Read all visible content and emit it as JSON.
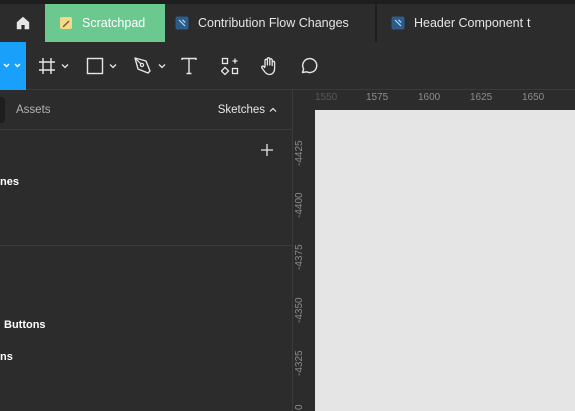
{
  "tabs": [
    {
      "label": "Scratchpad",
      "icon": "scratchpad-file-icon",
      "active": true
    },
    {
      "label": "Contribution Flow Changes",
      "icon": "figma-file-icon"
    },
    {
      "label": "Header Component",
      "icon": "figma-file-icon",
      "overflow_text": "t"
    }
  ],
  "colors": {
    "active_tab": "#6bc98f",
    "active_tool": "#18a0fb",
    "canvas": "#e5e5e5",
    "chrome": "#2c2c2c"
  },
  "toolbar": {
    "tools": [
      "move-tool",
      "frame-tool",
      "shape-tool",
      "pen-tool",
      "text-tool",
      "resources-tool",
      "hand-tool",
      "comment-tool"
    ]
  },
  "panel": {
    "assets_tab": "Assets",
    "page_selector": "Sketches",
    "pages": [
      "nes",
      "Buttons",
      "ns"
    ]
  },
  "rulers": {
    "top": [
      "1550",
      "1575",
      "1600",
      "1625",
      "1650"
    ],
    "left": [
      "-4425",
      "-4400",
      "-4375",
      "-4350",
      "-4325",
      "0"
    ]
  }
}
